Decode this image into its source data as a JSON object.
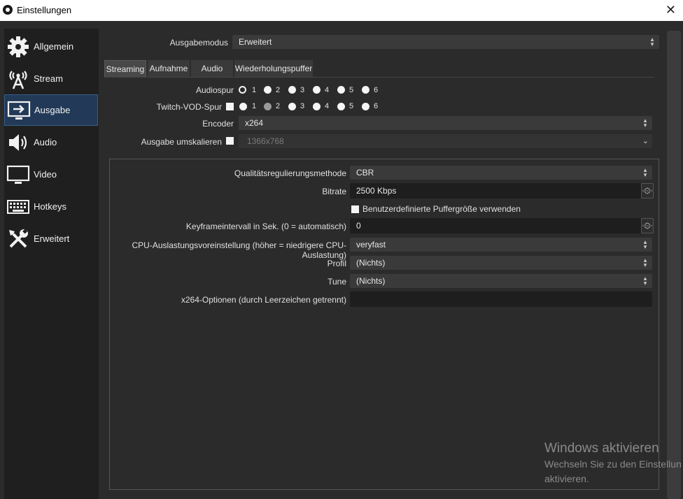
{
  "window": {
    "title": "Einstellungen",
    "close": "✕"
  },
  "sidebar": {
    "items": [
      {
        "label": "Allgemein",
        "icon": "gear-icon"
      },
      {
        "label": "Stream",
        "icon": "antenna-icon"
      },
      {
        "label": "Ausgabe",
        "icon": "output-icon",
        "active": true
      },
      {
        "label": "Audio",
        "icon": "speaker-icon"
      },
      {
        "label": "Video",
        "icon": "monitor-icon"
      },
      {
        "label": "Hotkeys",
        "icon": "keyboard-icon"
      },
      {
        "label": "Erweitert",
        "icon": "tools-icon"
      }
    ]
  },
  "output_mode": {
    "label": "Ausgabemodus",
    "value": "Erweitert"
  },
  "tabs": [
    "Streaming",
    "Aufnahme",
    "Audio",
    "Wiederholungspuffer"
  ],
  "streaming": {
    "audio_track": {
      "label": "Audiospur",
      "options": [
        "1",
        "2",
        "3",
        "4",
        "5",
        "6"
      ],
      "selected": "1"
    },
    "twitch_vod": {
      "label": "Twitch-VOD-Spur",
      "options": [
        "1",
        "2",
        "3",
        "4",
        "5",
        "6"
      ],
      "selected": "2"
    },
    "encoder": {
      "label": "Encoder",
      "value": "x264"
    },
    "rescale": {
      "label": "Ausgabe umskalieren",
      "value": "1366x768"
    }
  },
  "encoder_settings": {
    "rate_control": {
      "label": "Qualitätsregulierungsmethode",
      "value": "CBR"
    },
    "bitrate": {
      "label": "Bitrate",
      "value": "2500 Kbps"
    },
    "custom_buffer": {
      "label": "Benutzerdefinierte Puffergröße verwenden"
    },
    "keyframe": {
      "label": "Keyframeintervall in Sek. (0 = automatisch)",
      "value": "0"
    },
    "cpu_preset": {
      "label": "CPU-Auslastungsvoreinstellung (höher = niedrigere CPU-Auslastung)",
      "value": "veryfast"
    },
    "profile": {
      "label": "Profil",
      "value": "(Nichts)"
    },
    "tune": {
      "label": "Tune",
      "value": "(Nichts)"
    },
    "x264_options": {
      "label": "x264-Optionen (durch Leerzeichen getrennt)",
      "value": ""
    }
  },
  "watermark": {
    "line1": "Windows aktivieren",
    "line2": "Wechseln Sie zu den Einstellun",
    "line3": "aktivieren."
  }
}
